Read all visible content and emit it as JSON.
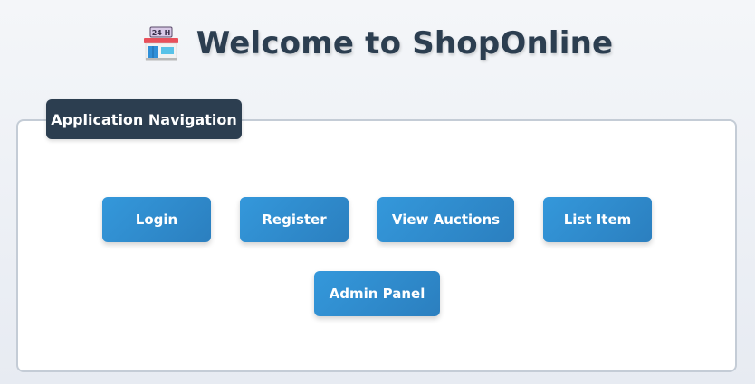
{
  "header": {
    "icon": "convenience-store-icon",
    "store_sign": "24 H",
    "title": "Welcome to ShopOnline"
  },
  "panel": {
    "legend": "Application Navigation"
  },
  "nav_buttons": {
    "login": "Login",
    "register": "Register",
    "view_auctions": "View Auctions",
    "list_item": "List Item",
    "admin_panel": "Admin Panel"
  },
  "colors": {
    "title": "#2c3e50",
    "legend_bg": "#2c3e50",
    "button_start": "#3498db",
    "button_end": "#2b7fbf",
    "panel_border": "#c4ccd6"
  }
}
